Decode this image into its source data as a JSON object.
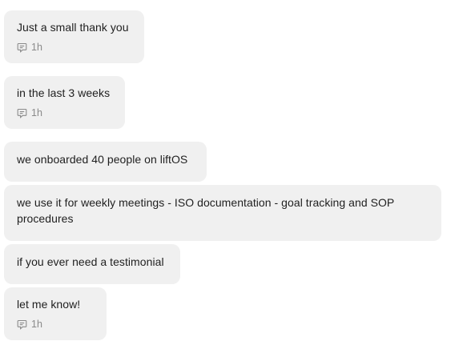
{
  "messages": [
    {
      "text": "Just a small thank you",
      "time": "1h"
    },
    {
      "text": "in the last 3 weeks",
      "time": "1h"
    },
    {
      "text": "we onboarded 40 people on liftOS"
    },
    {
      "text": "we use it for weekly meetings - ISO documentation - goal tracking and SOP procedures"
    },
    {
      "text": "if you ever need a testimonial"
    },
    {
      "text": "let me know!",
      "time": "1h"
    }
  ],
  "colors": {
    "bubble": "#f0f0f0",
    "meta": "#8a8a8a"
  },
  "icons": {
    "thread": "thread-reply-icon"
  }
}
